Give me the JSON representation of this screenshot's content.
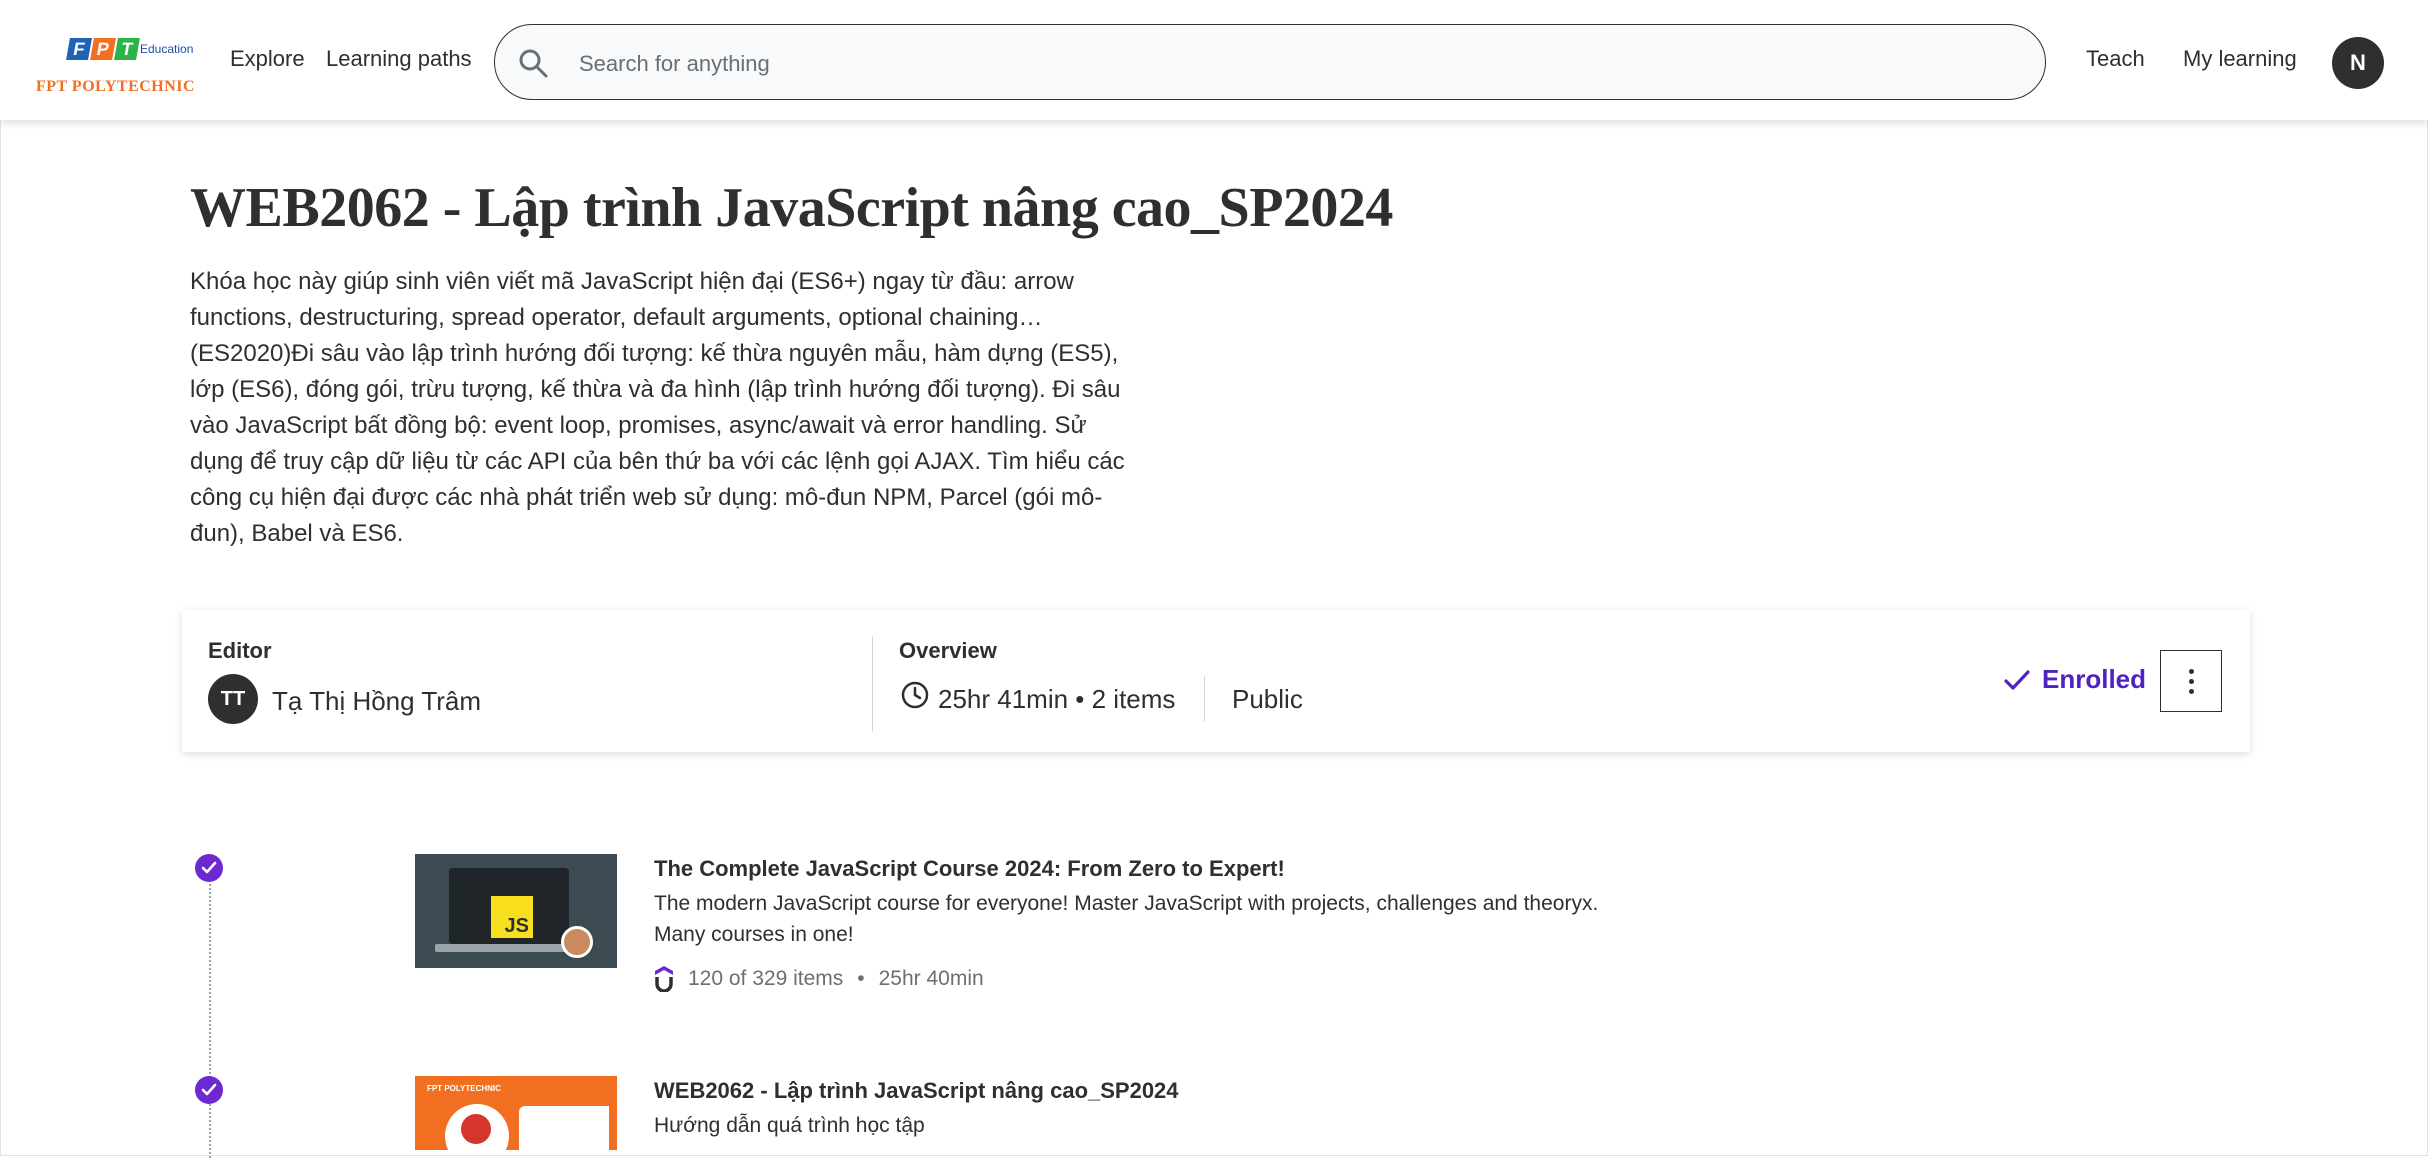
{
  "header": {
    "logo": {
      "brand_top": "FPT",
      "brand_letters": [
        "F",
        "P",
        "T"
      ],
      "education": "Education",
      "poly": "FPT POLYTECHNIC"
    },
    "nav": {
      "explore": "Explore",
      "learning_paths": "Learning paths",
      "teach": "Teach",
      "my_learning": "My learning"
    },
    "search": {
      "placeholder": "Search for anything",
      "icon": "search-icon"
    },
    "user_initial": "N"
  },
  "course": {
    "title": "WEB2062 - Lập trình JavaScript nâng cao_SP2024",
    "description": "Khóa học này giúp sinh viên viết mã JavaScript hiện đại (ES6+) ngay từ đầu: arrow functions, destructuring, spread operator, default arguments, optional chaining…(ES2020)Đi sâu vào lập trình hướng đối tượng: kế thừa nguyên mẫu, hàm dựng (ES5), lớp (ES6), đóng gói, trừu tượng, kế thừa và đa hình (lập trình hướng đối tượng). Đi sâu vào JavaScript bất đồng bộ: event loop, promises, async/await và error handling. Sử dụng để truy cập dữ liệu từ các API của bên thứ ba với các lệnh gọi AJAX. Tìm hiểu các công cụ hiện đại được các nhà phát triển web sử dụng: mô-đun NPM, Parcel (gói mô-đun), Babel và ES6."
  },
  "info": {
    "editor_label": "Editor",
    "editor_initials": "TT",
    "editor_name": "Tạ Thị Hồng Trâm",
    "overview_label": "Overview",
    "overview_text": "25hr 41min • 2 items",
    "visibility": "Public",
    "enrolled_label": "Enrolled",
    "colors": {
      "accent": "#5022c3",
      "check": "#6d28d2"
    }
  },
  "items": [
    {
      "title": "The Complete JavaScript Course 2024: From Zero to Expert!",
      "description": "The modern JavaScript course for everyone! Master JavaScript with projects, challenges and theoryx. Many courses in one!",
      "thumb_text": "JS",
      "provider_icon": "udemy-icon",
      "progress": "120 of 329 items",
      "duration": "25hr 40min",
      "completed": true
    },
    {
      "title": "WEB2062 - Lập trình JavaScript nâng cao_SP2024",
      "description": "Hướng dẫn quá trình học tập",
      "thumb_text": "FPT POLYTECHNIC",
      "completed": true
    }
  ]
}
